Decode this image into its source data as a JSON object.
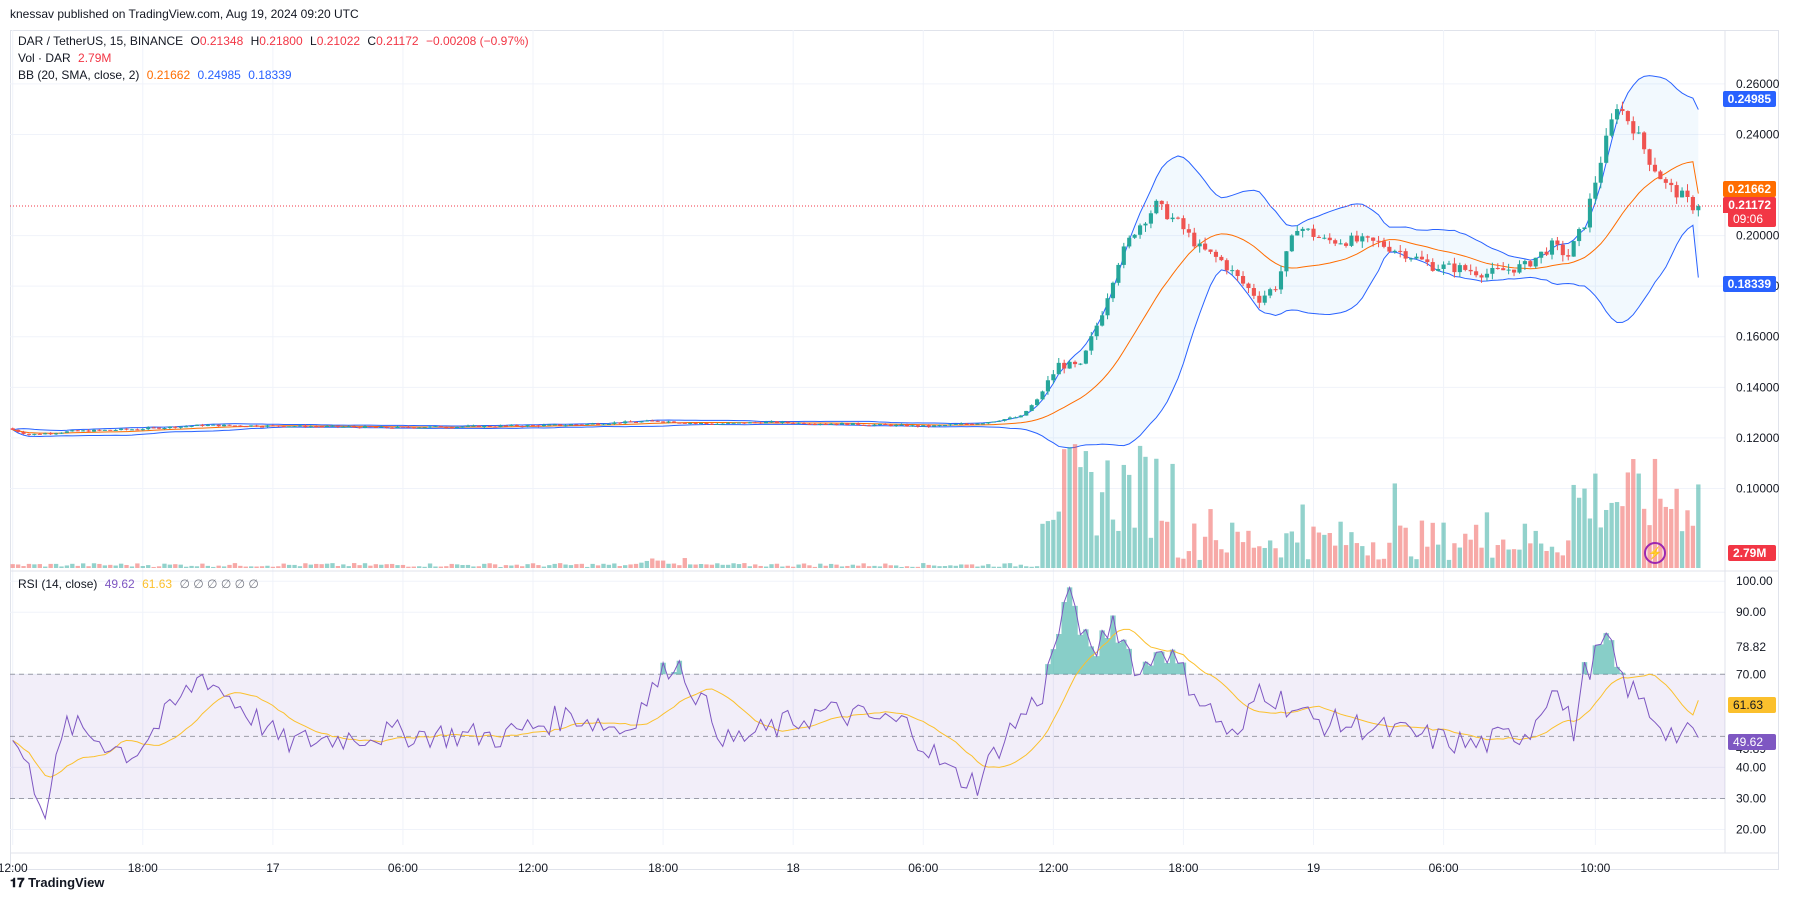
{
  "publisher": "knessav published on TradingView.com, Aug 19, 2024 09:20 UTC",
  "logo_text": "TradingView",
  "symbol": {
    "title": "DAR / TetherUS, 15, BINANCE",
    "o_label": "O",
    "o": "0.21348",
    "h_label": "H",
    "h": "0.21800",
    "l_label": "L",
    "l": "0.21022",
    "c_label": "C",
    "c": "0.21172",
    "change": "−0.00208 (−0.97%)"
  },
  "volume": {
    "label": "Vol · DAR",
    "value": "2.79M"
  },
  "bb": {
    "label": "BB (20, SMA, close, 2)",
    "basis": "0.21662",
    "upper": "0.24985",
    "lower": "0.18339"
  },
  "rsi": {
    "label": "RSI (14, close)",
    "value": "49.62",
    "ma": "61.63",
    "extras": "∅ ∅ ∅ ∅ ∅ ∅"
  },
  "price_tags": {
    "upper": "0.24985",
    "basis": "0.21662",
    "last": "0.21172",
    "countdown": "09:06",
    "lower": "0.18339",
    "volume": "2.79M"
  },
  "rsi_tags": {
    "high": "78.82",
    "ma": "61.63",
    "value": "49.62",
    "low": "45.89"
  },
  "colors": {
    "up": "#26a69a",
    "down": "#ef5350",
    "basis": "#ff6d00",
    "band": "#2962ff",
    "rsi": "#7e57c2",
    "rsi_ma": "#fbc02d"
  },
  "chart_data": {
    "type": "candlestick",
    "x_ticks": [
      "12:00",
      "18:00",
      "17",
      "06:00",
      "12:00",
      "18:00",
      "18",
      "06:00",
      "12:00",
      "18:00",
      "19",
      "06:00",
      "10:00"
    ],
    "price_ticks": [
      "0.26000",
      "0.24000",
      "0.20000",
      "0.18000",
      "0.16000",
      "0.14000",
      "0.12000",
      "0.10000"
    ],
    "ylim": [
      0.0895,
      0.2655
    ],
    "rsi_ticks": [
      "100.00",
      "90.00",
      "70.00",
      "40.00",
      "30.00",
      "20.00"
    ],
    "rsi_ylim": [
      15,
      102
    ],
    "rsi_levels": [
      70,
      50,
      30
    ],
    "price_knots": [
      [
        0,
        0.1238
      ],
      [
        4,
        0.1213
      ],
      [
        12,
        0.1226
      ],
      [
        24,
        0.1235
      ],
      [
        36,
        0.125
      ],
      [
        52,
        0.1247
      ],
      [
        70,
        0.1241
      ],
      [
        86,
        0.1245
      ],
      [
        103,
        0.1251
      ],
      [
        120,
        0.1267
      ],
      [
        130,
        0.1255
      ],
      [
        140,
        0.1262
      ],
      [
        155,
        0.1255
      ],
      [
        170,
        0.1246
      ],
      [
        180,
        0.126
      ],
      [
        187,
        0.1285
      ],
      [
        190,
        0.135
      ],
      [
        194,
        0.149
      ],
      [
        198,
        0.148
      ],
      [
        202,
        0.17
      ],
      [
        205,
        0.19
      ],
      [
        208,
        0.202
      ],
      [
        212,
        0.212
      ],
      [
        216,
        0.205
      ],
      [
        220,
        0.195
      ],
      [
        224,
        0.19
      ],
      [
        228,
        0.181
      ],
      [
        231,
        0.175
      ],
      [
        234,
        0.18
      ],
      [
        238,
        0.204
      ],
      [
        243,
        0.198
      ],
      [
        248,
        0.198
      ],
      [
        253,
        0.197
      ],
      [
        258,
        0.193
      ],
      [
        263,
        0.188
      ],
      [
        268,
        0.187
      ],
      [
        273,
        0.185
      ],
      [
        280,
        0.188
      ],
      [
        285,
        0.196
      ],
      [
        288,
        0.192
      ],
      [
        291,
        0.205
      ],
      [
        294,
        0.23
      ],
      [
        297,
        0.252
      ],
      [
        300,
        0.243
      ],
      [
        303,
        0.23
      ],
      [
        306,
        0.22
      ],
      [
        309,
        0.2155
      ],
      [
        311,
        0.2117
      ]
    ],
    "rsi_knots": [
      [
        0,
        50
      ],
      [
        6,
        27
      ],
      [
        10,
        54
      ],
      [
        22,
        44
      ],
      [
        35,
        70
      ],
      [
        50,
        48
      ],
      [
        70,
        51
      ],
      [
        90,
        50
      ],
      [
        103,
        57
      ],
      [
        113,
        52
      ],
      [
        122,
        75
      ],
      [
        132,
        48
      ],
      [
        150,
        58
      ],
      [
        165,
        54
      ],
      [
        173,
        38
      ],
      [
        178,
        35
      ],
      [
        183,
        50
      ],
      [
        190,
        64
      ],
      [
        195,
        98
      ],
      [
        199,
        75
      ],
      [
        203,
        88
      ],
      [
        208,
        70
      ],
      [
        212,
        80
      ],
      [
        220,
        60
      ],
      [
        226,
        48
      ],
      [
        230,
        66
      ],
      [
        240,
        55
      ],
      [
        250,
        53
      ],
      [
        260,
        50
      ],
      [
        270,
        47
      ],
      [
        280,
        52
      ],
      [
        284,
        67
      ],
      [
        288,
        52
      ],
      [
        290,
        70
      ],
      [
        294,
        81
      ],
      [
        297,
        68
      ],
      [
        303,
        56
      ],
      [
        306,
        51
      ],
      [
        309,
        50
      ],
      [
        311,
        49.62
      ]
    ],
    "rsi_ma_last": 61.63,
    "volume_last": "2.79M",
    "bb_last": {
      "upper": 0.24985,
      "basis": 0.21662,
      "lower": 0.18339
    },
    "last_close": 0.21172
  }
}
